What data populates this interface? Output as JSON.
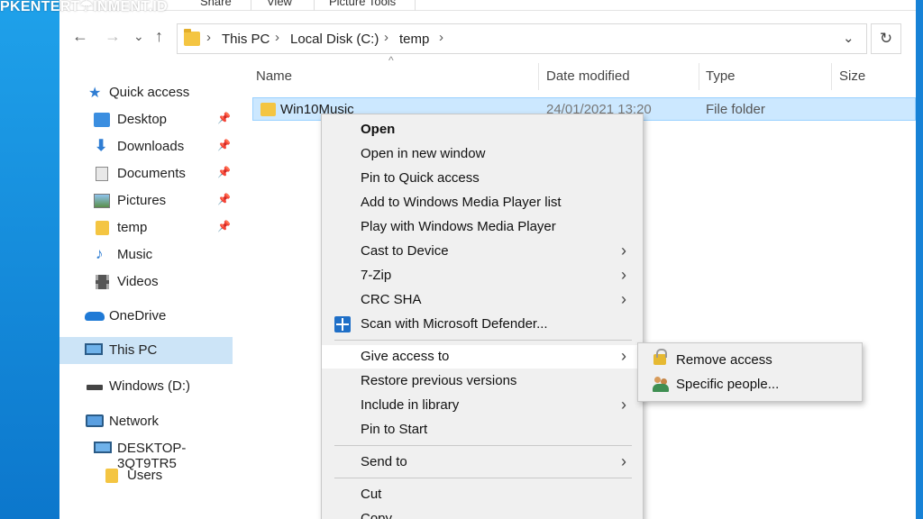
{
  "watermark": "PKENTERT☂INMENT.ID",
  "ribbon": {
    "tabs": [
      "Share",
      "View",
      "Picture Tools"
    ]
  },
  "address": {
    "crumbs": [
      "This PC",
      "Local Disk (C:)",
      "temp"
    ]
  },
  "icons": {
    "back": "←",
    "forward": "→",
    "recent": "⌄",
    "up": "↑",
    "dropdown": "⌄",
    "refresh": "↻",
    "chevron": "›",
    "pin": "📌"
  },
  "sidebar": {
    "items": [
      {
        "label": "Quick access"
      },
      {
        "label": "Desktop"
      },
      {
        "label": "Downloads"
      },
      {
        "label": "Documents"
      },
      {
        "label": "Pictures"
      },
      {
        "label": "temp"
      },
      {
        "label": "Music"
      },
      {
        "label": "Videos"
      },
      {
        "label": "OneDrive"
      },
      {
        "label": "This PC"
      },
      {
        "label": "Windows (D:)"
      },
      {
        "label": "Network"
      },
      {
        "label": "DESKTOP-3QT9TR5"
      },
      {
        "label": "Users"
      }
    ]
  },
  "columns": {
    "name": "Name",
    "date": "Date modified",
    "type": "Type",
    "size": "Size"
  },
  "file": {
    "name": "Win10Music",
    "date": "24/01/2021 13:20",
    "type": "File folder"
  },
  "context_menu": {
    "items": [
      {
        "label": "Open"
      },
      {
        "label": "Open in new window"
      },
      {
        "label": "Pin to Quick access"
      },
      {
        "label": "Add to Windows Media Player list"
      },
      {
        "label": "Play with Windows Media Player"
      },
      {
        "label": "Cast to Device"
      },
      {
        "label": "7-Zip"
      },
      {
        "label": "CRC SHA"
      },
      {
        "label": "Scan with Microsoft Defender..."
      },
      {
        "label": "Give access to"
      },
      {
        "label": "Restore previous versions"
      },
      {
        "label": "Include in library"
      },
      {
        "label": "Pin to Start"
      },
      {
        "label": "Send to"
      },
      {
        "label": "Cut"
      },
      {
        "label": "Copy"
      }
    ],
    "arrow": "›"
  },
  "submenu": {
    "items": [
      {
        "label": "Remove access"
      },
      {
        "label": "Specific people..."
      }
    ]
  },
  "colors": {
    "accent": "#0078d7",
    "selection": "#cce8ff",
    "selection_border": "#99d1ff",
    "menu_bg": "#f0f0f0"
  }
}
